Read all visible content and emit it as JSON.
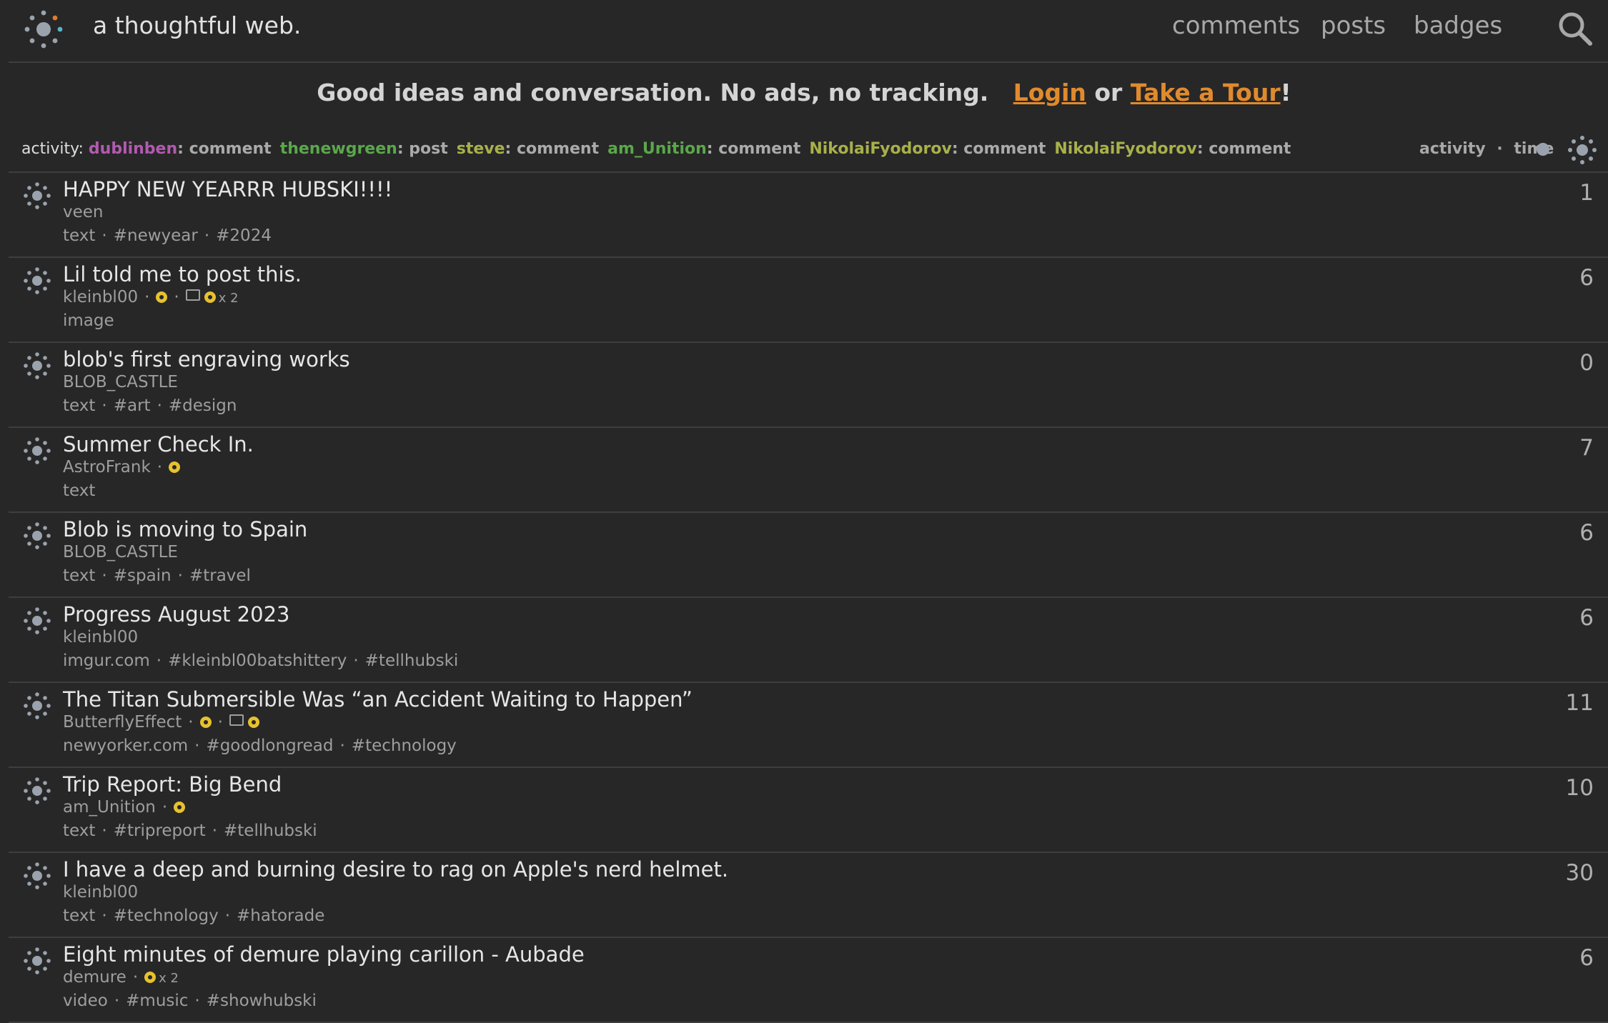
{
  "header": {
    "site_name": "a thoughtful web.",
    "nav": {
      "comments": "comments",
      "posts": "posts",
      "badges": "badges"
    }
  },
  "tagline": {
    "text": "Good ideas and conversation. No ads, no tracking.",
    "login": "Login",
    "or": "or",
    "tour": "Take a Tour",
    "end": "!"
  },
  "activity": {
    "label": "activity:",
    "entries": [
      {
        "user": "dublinben",
        "kind": ": comment",
        "color": "#b25ab0"
      },
      {
        "user": "thenewgreen",
        "kind": ": post",
        "color": "#5aa84a"
      },
      {
        "user": "steve",
        "kind": ": comment",
        "color": "#a8b14a"
      },
      {
        "user": "am_Unition",
        "kind": ": comment",
        "color": "#5aa84a"
      },
      {
        "user": "NikolaiFyodorov",
        "kind": ": comment",
        "color": "#a8b14a"
      },
      {
        "user": "NikolaiFyodorov",
        "kind": ": comment",
        "color": "#a8b14a"
      }
    ],
    "sort_activity": "activity",
    "sort_sep": "·",
    "sort_time": "time"
  },
  "posts": [
    {
      "title": "HAPPY NEW YEARRR HUBSKI!!!!",
      "author": "veen",
      "badges": "",
      "meta": [
        "text",
        "#newyear",
        "#2024"
      ],
      "count": "1"
    },
    {
      "title": "Lil told me to post this.",
      "author": "kleinbl00",
      "badges": "badge-cmtbadge-x2",
      "meta": [
        "image"
      ],
      "count": "6",
      "mult": "x 2"
    },
    {
      "title": "blob's first engraving works",
      "author": "BLOB_CASTLE",
      "badges": "",
      "meta": [
        "text",
        "#art",
        "#design"
      ],
      "count": "0"
    },
    {
      "title": "Summer Check In.",
      "author": "AstroFrank",
      "badges": "badge",
      "meta": [
        "text"
      ],
      "count": "7"
    },
    {
      "title": "Blob is moving to Spain",
      "author": "BLOB_CASTLE",
      "badges": "",
      "meta": [
        "text",
        "#spain",
        "#travel"
      ],
      "count": "6"
    },
    {
      "title": "Progress August 2023",
      "author": "kleinbl00",
      "badges": "",
      "meta": [
        "imgur.com",
        "#kleinbl00batshittery",
        "#tellhubski"
      ],
      "count": "6"
    },
    {
      "title": "The Titan Submersible Was “an Accident Waiting to Happen”",
      "author": "ButterflyEffect",
      "badges": "badge-cmtbadge",
      "meta": [
        "newyorker.com",
        "#goodlongread",
        "#technology"
      ],
      "count": "11"
    },
    {
      "title": "Trip Report: Big Bend",
      "author": "am_Unition",
      "badges": "badge",
      "meta": [
        "text",
        "#tripreport",
        "#tellhubski"
      ],
      "count": "10"
    },
    {
      "title": "I have a deep and burning desire to rag on Apple's nerd helmet.",
      "author": "kleinbl00",
      "badges": "",
      "meta": [
        "text",
        "#technology",
        "#hatorade"
      ],
      "count": "30"
    },
    {
      "title": "Eight minutes of demure playing carillon - Aubade",
      "author": "demure",
      "badges": "badge-x2",
      "meta": [
        "video",
        "#music",
        "#showhubski"
      ],
      "count": "6",
      "mult": "x 2"
    }
  ],
  "colors": {
    "accent": "#e08a2e",
    "badge": "#e7c12e",
    "background": "#272727"
  }
}
